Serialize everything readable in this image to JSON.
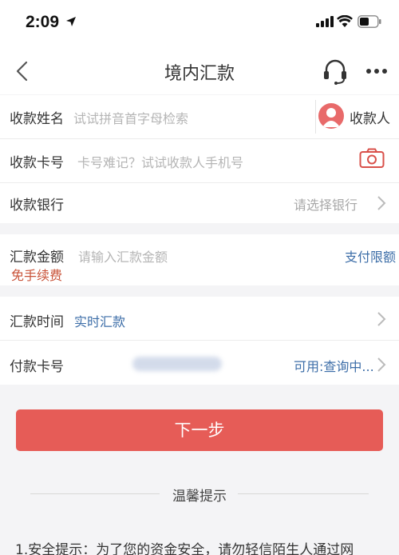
{
  "status_bar": {
    "time": "2:09"
  },
  "header": {
    "title": "境内汇款"
  },
  "form": {
    "name": {
      "label": "收款姓名",
      "placeholder": "试试拼音首字母检索",
      "recipient_label": "收款人"
    },
    "card": {
      "label": "收款卡号",
      "placeholder": "卡号难记？试试收款人手机号"
    },
    "bank": {
      "label": "收款银行",
      "placeholder": "请选择银行"
    },
    "amount": {
      "label": "汇款金额",
      "placeholder": "请输入汇款金额",
      "limit_link": "支付限额",
      "fee_badge": "免手续费"
    },
    "time": {
      "label": "汇款时间",
      "value": "实时汇款"
    },
    "pay_card": {
      "label": "付款卡号",
      "available": "可用:查询中..."
    }
  },
  "next_button": "下一步",
  "tips": {
    "title": "温馨提示",
    "text": "1.安全提示：为了您的资金安全，请勿轻信陌生人通过网"
  },
  "colors": {
    "primary": "#e65c57",
    "link": "#3d6ea8",
    "fee": "#c9543a"
  }
}
